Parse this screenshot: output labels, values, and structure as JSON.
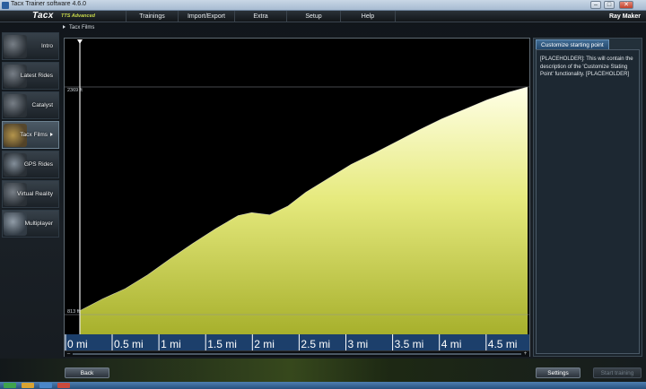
{
  "window": {
    "title": "Tacx Trainer software 4.6.0",
    "buttons": [
      "–",
      "□",
      "✕"
    ]
  },
  "brand": {
    "logo": "Tacx",
    "edition": "TTS Advanced"
  },
  "menu": {
    "items": [
      "Trainings",
      "Import/Export",
      "Extra",
      "Setup",
      "Help"
    ],
    "user": "Ray Maker"
  },
  "breadcrumb": "Tacx Films",
  "sidebar": {
    "items": [
      {
        "label": "Intro",
        "icon": "intro-icon"
      },
      {
        "label": "Latest Rides",
        "icon": "latest-rides-icon"
      },
      {
        "label": "Catalyst",
        "icon": "catalyst-icon"
      },
      {
        "label": "Tacx Films",
        "icon": "tacx-films-icon",
        "active": true
      },
      {
        "label": "GPS Rides",
        "icon": "gps-rides-icon"
      },
      {
        "label": "Virtual Reality",
        "icon": "virtual-reality-icon"
      },
      {
        "label": "Multiplayer",
        "icon": "multiplayer-icon"
      }
    ]
  },
  "chart_data": {
    "type": "area",
    "title": "",
    "xlabel": "",
    "ylabel": "",
    "x_ticks": [
      "0 mi",
      "0.5 mi",
      "1 mi",
      "1.5 mi",
      "2 mi",
      "2.5 mi",
      "3 mi",
      "3.5 mi",
      "4 mi",
      "4.5 mi"
    ],
    "x_unit": "mi",
    "xlim": [
      0,
      4.95
    ],
    "y_labels": {
      "max": "2369 ft",
      "min": "813 ft"
    },
    "ylim": [
      813,
      2369
    ],
    "series": [
      {
        "x": [
          0,
          0.25,
          0.5,
          0.75,
          1.0,
          1.25,
          1.5,
          1.75,
          1.9,
          2.1,
          2.3,
          2.5,
          2.75,
          3.0,
          3.25,
          3.5,
          3.75,
          4.0,
          4.25,
          4.5,
          4.75,
          4.95
        ],
        "y": [
          840,
          920,
          990,
          1085,
          1195,
          1300,
          1400,
          1490,
          1510,
          1495,
          1555,
          1650,
          1745,
          1840,
          1915,
          1995,
          2075,
          2150,
          2215,
          2280,
          2335,
          2369
        ]
      }
    ],
    "fill_colors": {
      "top": "#ffffe6",
      "middle": "#e6ea7e",
      "bottom": "#a7b02c"
    },
    "axis_band_color": "#1c3f6b",
    "marker_line": "start"
  },
  "right_panel": {
    "tab": "Customize starting point",
    "description": "[PLACEHOLDER]: This will contain the description of the 'Customize Stating Point' functionality. [PLACEHOLDER]"
  },
  "buttons": {
    "back": "Back",
    "settings": "Settings",
    "start": "Start training"
  },
  "scrollbar": {
    "left": "–",
    "right": "+"
  }
}
